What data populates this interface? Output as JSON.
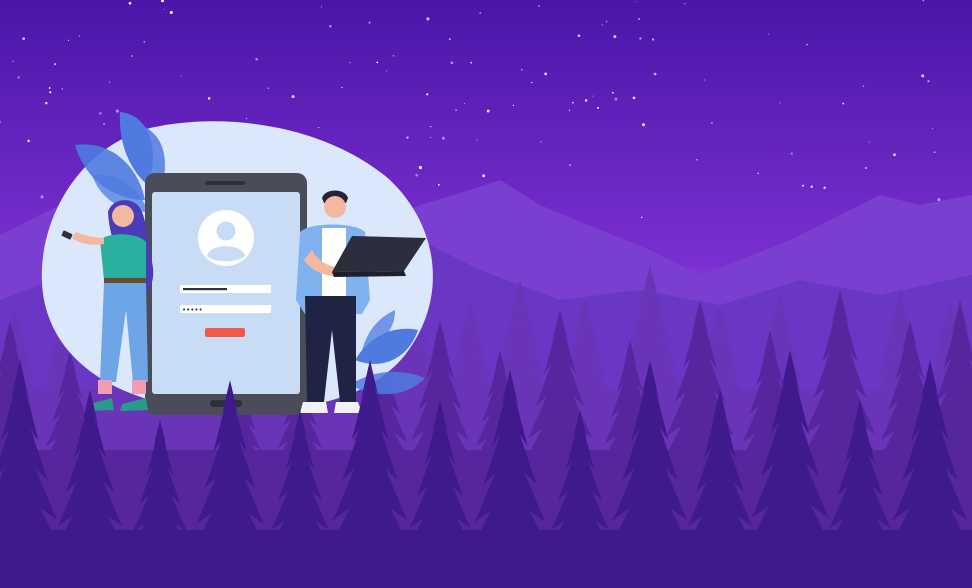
{
  "scene": {
    "sky_top": "#4a16a8",
    "sky_mid": "#7b2fd0",
    "sky_glow": "#c07be8",
    "mountain_far": "#7a3fd0",
    "mountain_near": "#6a36c4",
    "forest_back": "#6a34b8",
    "forest_mid": "#55269e",
    "forest_front": "#3f1a8c",
    "blob": "#dbe7fb",
    "leaf": "#4f7be0"
  },
  "phone": {
    "frame": "#4a4c5a",
    "screen": "#c9dcf6",
    "avatar": "#ffffff",
    "username_field_value": "",
    "password_mask": "•••••",
    "login_button_color": "#ef5b4b"
  },
  "woman": {
    "hair": "#4a3bb8",
    "top": "#2bb0a0",
    "jeans": "#6ea5e6",
    "socks": "#f29bb4"
  },
  "man": {
    "shirt": "#7fb2ee",
    "tee": "#ffffff",
    "pants": "#1f2444",
    "laptop": "#2c2e3e"
  }
}
